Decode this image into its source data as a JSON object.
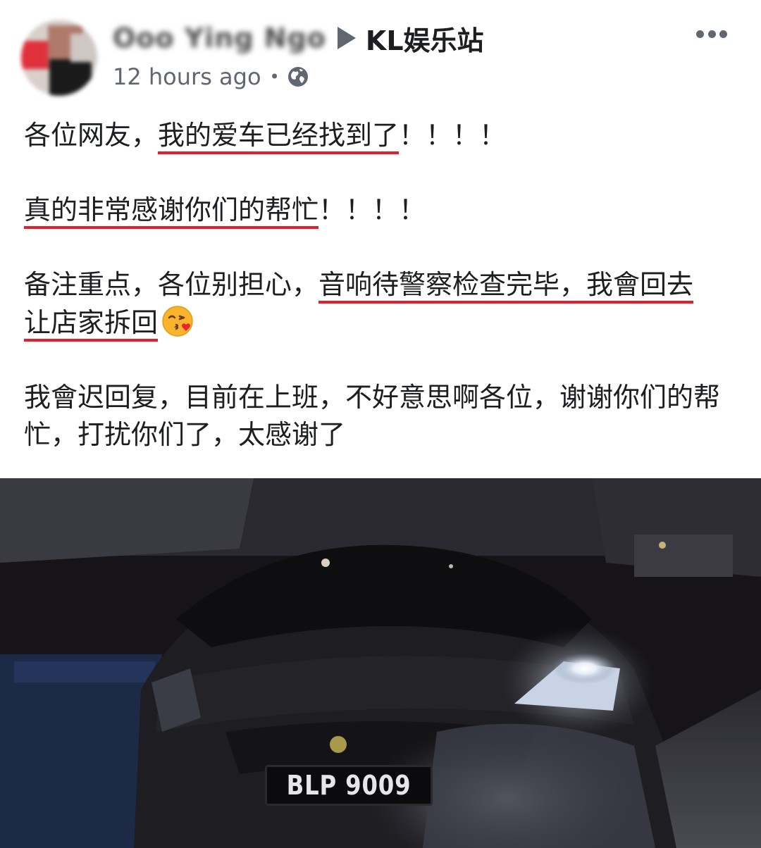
{
  "post": {
    "author_name": "Ooo Ying Ngo",
    "group_name": "KL娱乐站",
    "timestamp": "12 hours ago",
    "separator": "•",
    "privacy_icon": "globe-icon",
    "more_icon": "more-options-icon"
  },
  "body": {
    "p1": {
      "plain_before": "各位网友，",
      "underlined": "我的爱车已经找到了",
      "plain_after": "！！！！"
    },
    "p2": {
      "underlined": "真的非常感谢你们的帮忙",
      "plain_after": "！！！！"
    },
    "p3": {
      "plain_before": "备注重点，各位别担心，",
      "underlined_line1": "音响待警察检查完毕，我會回去",
      "underlined_line2": "让店家拆回",
      "emoji": "kissing-face-with-heart-emoji"
    },
    "p4": {
      "text": "我會迟回复，目前在上班，不好意思啊各位，谢谢你们的帮忙，打扰你们了，太感谢了"
    }
  },
  "photo": {
    "plate_number": "BLP 9009"
  },
  "colors": {
    "underline": "#e0202c",
    "text": "#1c1e21",
    "secondary": "#616770"
  }
}
